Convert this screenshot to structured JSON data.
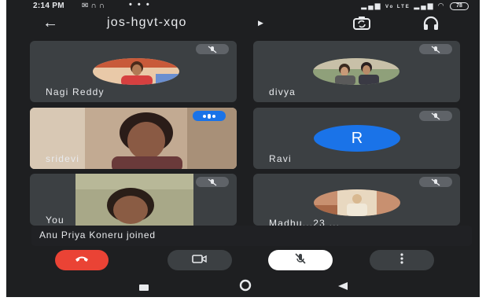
{
  "status_bar": {
    "time": "2:14 PM",
    "left_icons": [
      "messenger-icon",
      "headset-icon",
      "headset-icon"
    ],
    "dots": "• • •",
    "network_text": "Vo LTE",
    "battery": "78"
  },
  "header": {
    "meeting_code": "jos-hgvt-xqo",
    "icons": [
      "back-arrow-icon",
      "caret-right-icon",
      "switch-camera-icon",
      "headset-icon"
    ]
  },
  "participants": [
    {
      "name": "Nagi Reddy",
      "muted": true,
      "avatar": "photo"
    },
    {
      "name": "divya",
      "muted": true,
      "avatar": "photo"
    },
    {
      "name": "sridevi",
      "muted": false,
      "speaking": true,
      "avatar": "video"
    },
    {
      "name": "Ravi",
      "muted": true,
      "avatar": "initial",
      "initial": "R",
      "avatar_color": "#1a73e8"
    },
    {
      "name": "You",
      "muted": true,
      "avatar": "video"
    },
    {
      "name": "Madhu...23 ...",
      "muted": true,
      "avatar": "photo"
    }
  ],
  "toast": {
    "text": "Anu Priya Koneru joined"
  },
  "controls": {
    "end_call_color": "#ea4335",
    "buttons": [
      "end-call-icon",
      "camera-icon",
      "mic-off-icon",
      "more-vert-icon"
    ]
  },
  "nav": [
    "recents-icon",
    "home-icon",
    "back-icon"
  ]
}
